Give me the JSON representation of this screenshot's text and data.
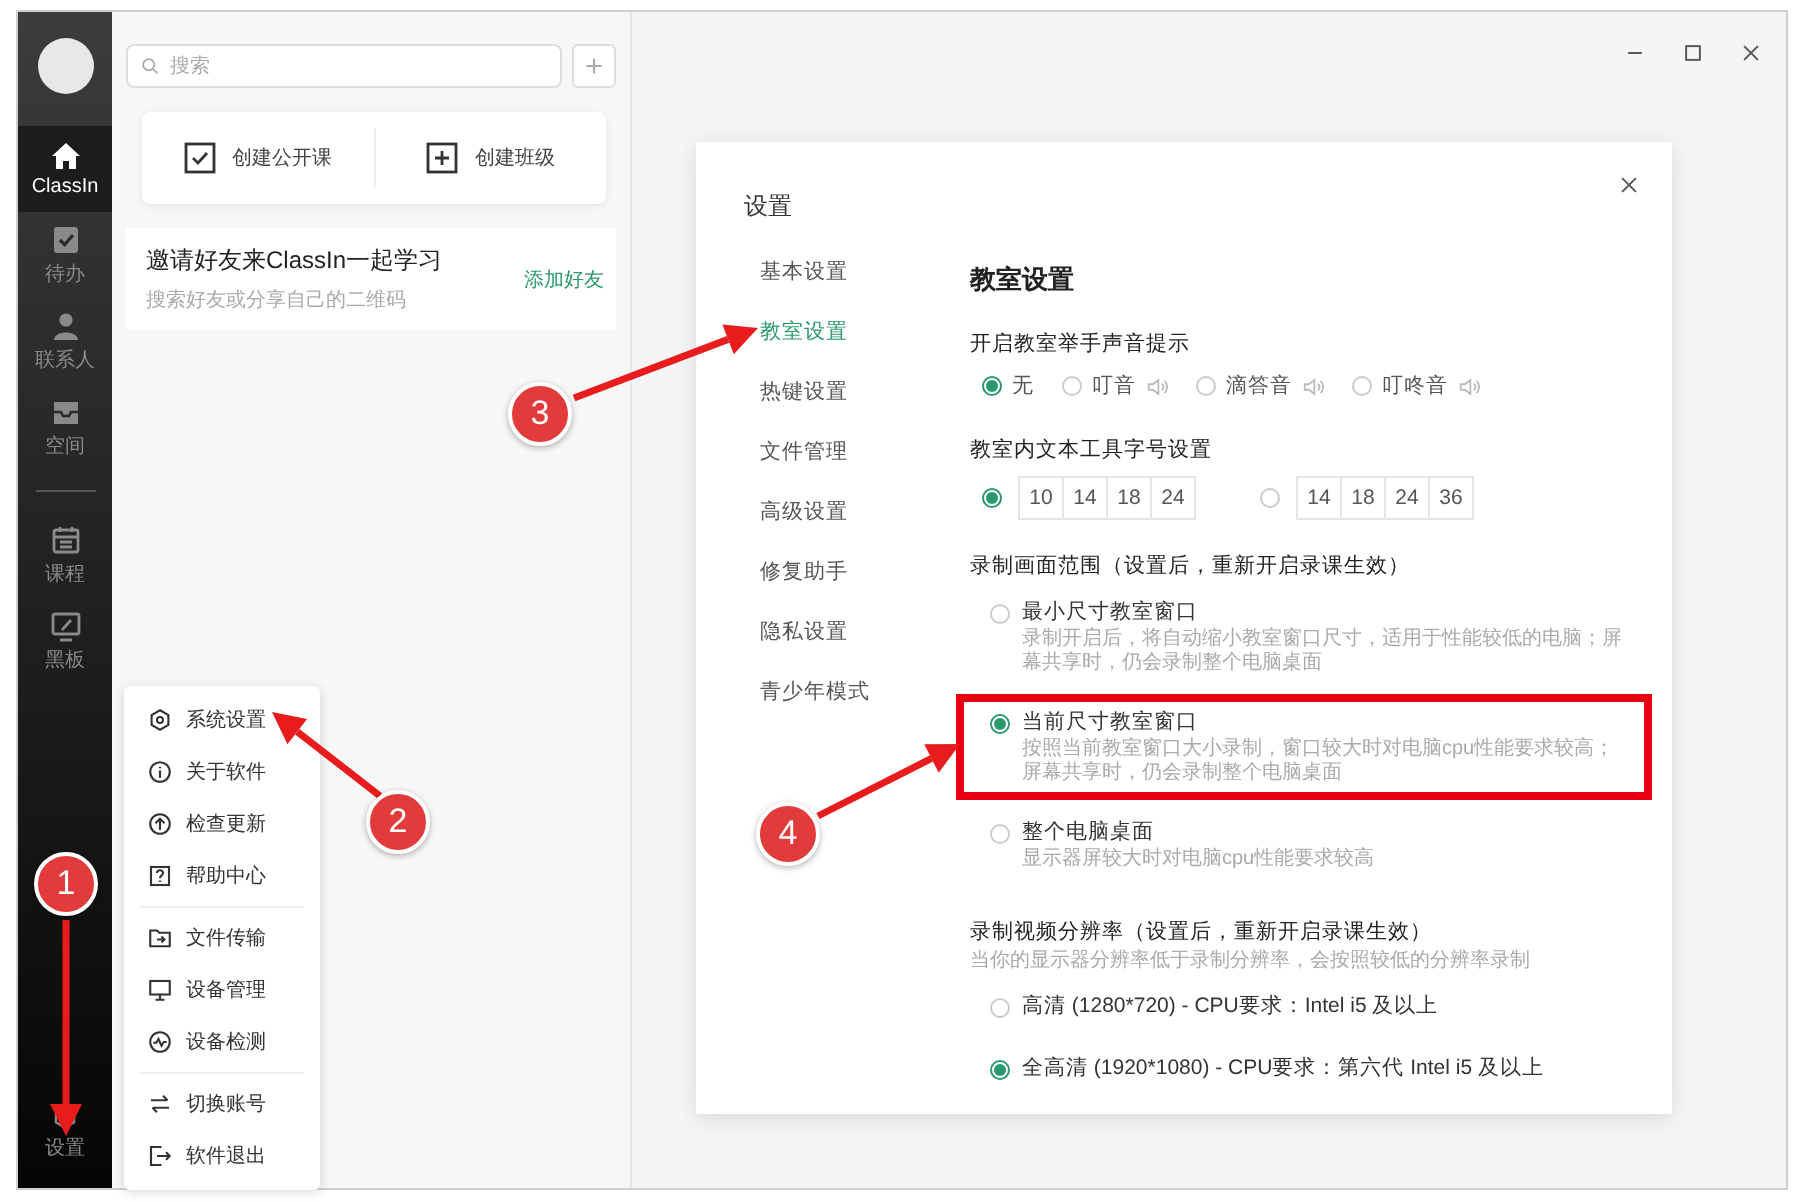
{
  "sidebar": {
    "items": [
      {
        "label": "ClassIn",
        "selected": true
      },
      {
        "label": "待办",
        "selected": false
      },
      {
        "label": "联系人",
        "selected": false
      },
      {
        "label": "空间",
        "selected": false
      },
      {
        "label": "课程",
        "selected": false
      },
      {
        "label": "黑板",
        "selected": false
      }
    ],
    "settings_label": "设置"
  },
  "middle": {
    "search": {
      "placeholder": "搜索"
    },
    "quick_actions": [
      "创建公开课",
      "创建班级"
    ],
    "invite": {
      "title": "邀请好友来ClassIn一起学习",
      "subtitle": "搜索好友或分享自己的二维码",
      "link": "添加好友"
    }
  },
  "menu": {
    "groups": [
      [
        "系统设置",
        "关于软件",
        "检查更新",
        "帮助中心"
      ],
      [
        "文件传输",
        "设备管理",
        "设备检测"
      ],
      [
        "切换账号",
        "软件退出"
      ]
    ]
  },
  "dialog": {
    "title": "设置",
    "nav": [
      {
        "label": "基本设置",
        "selected": false
      },
      {
        "label": "教室设置",
        "selected": true
      },
      {
        "label": "热键设置",
        "selected": false
      },
      {
        "label": "文件管理",
        "selected": false
      },
      {
        "label": "高级设置",
        "selected": false
      },
      {
        "label": "修复助手",
        "selected": false
      },
      {
        "label": "隐私设置",
        "selected": false
      },
      {
        "label": "青少年模式",
        "selected": false
      }
    ],
    "section_title": "教室设置",
    "groups": [
      {
        "kind": "radio_row",
        "label": "开启教室举手声音提示",
        "options": [
          {
            "label": "无",
            "selected": true,
            "sound": false
          },
          {
            "label": "叮音",
            "selected": false,
            "sound": true
          },
          {
            "label": "滴答音",
            "selected": false,
            "sound": true
          },
          {
            "label": "叮咚音",
            "selected": false,
            "sound": true
          }
        ]
      },
      {
        "kind": "font_sizes",
        "label": "教室内文本工具字号设置",
        "options": [
          {
            "selected": true,
            "sizes": [
              "10",
              "14",
              "18",
              "24"
            ]
          },
          {
            "selected": false,
            "sizes": [
              "14",
              "18",
              "24",
              "36"
            ]
          }
        ]
      },
      {
        "kind": "radio_list",
        "label": "录制画面范围（设置后，重新开启录课生效）",
        "options": [
          {
            "label": "最小尺寸教室窗口",
            "selected": false,
            "highlighted": false,
            "description": "录制开启后，将自动缩小教室窗口尺寸，适用于性能较低的电脑；屏幕共享时，仍会录制整个电脑桌面"
          },
          {
            "label": "当前尺寸教室窗口",
            "selected": true,
            "highlighted": true,
            "description": "按照当前教室窗口大小录制，窗口较大时对电脑cpu性能要求较高；屏幕共享时，仍会录制整个电脑桌面"
          },
          {
            "label": "整个电脑桌面",
            "selected": false,
            "highlighted": false,
            "description": "显示器屏较大时对电脑cpu性能要求较高"
          }
        ]
      },
      {
        "kind": "radio_list",
        "label": "录制视频分辨率（设置后，重新开启录课生效）",
        "note": "当你的显示器分辨率低于录制分辨率，会按照较低的分辨率录制",
        "options": [
          {
            "label": "高清 (1280*720) - CPU要求：Intel i5 及以上",
            "selected": false,
            "highlighted": false
          },
          {
            "label": "全高清 (1920*1080) - CPU要求：第六代 Intel i5 及以上",
            "selected": true,
            "highlighted": false
          }
        ]
      }
    ]
  },
  "annotations": [
    "1",
    "2",
    "3",
    "4"
  ]
}
